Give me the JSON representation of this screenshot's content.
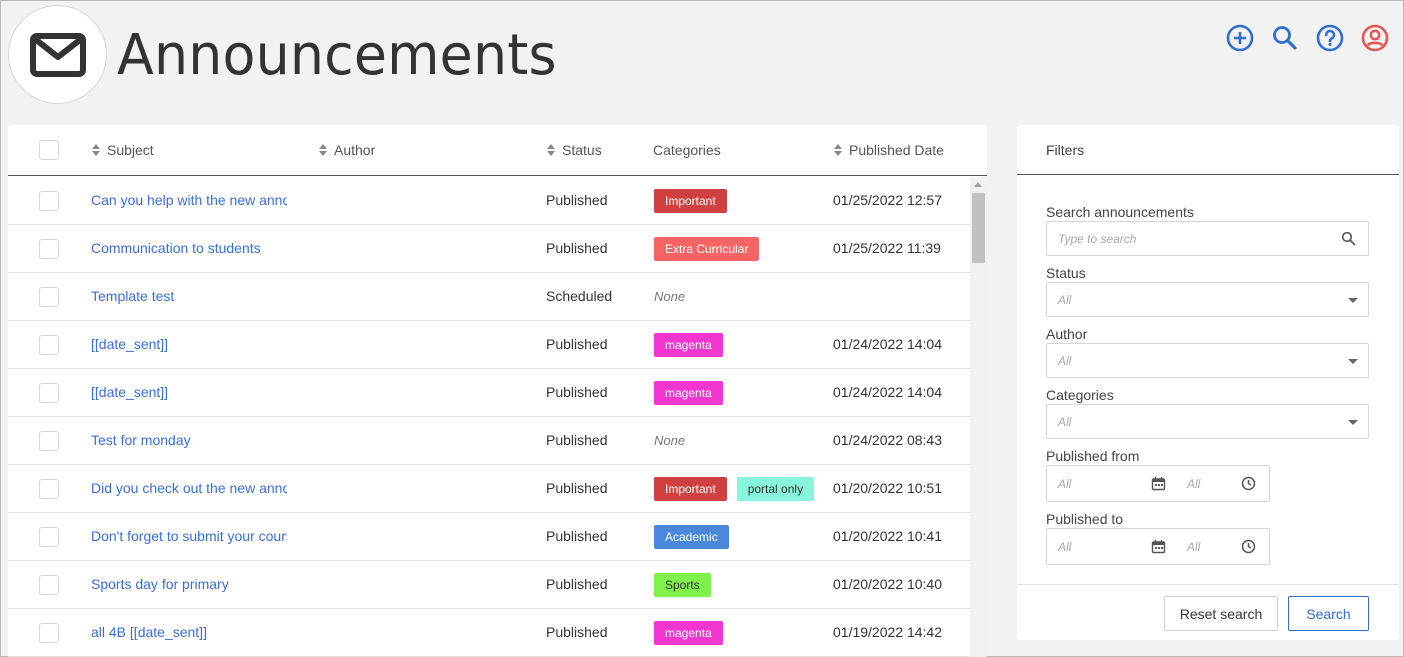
{
  "header": {
    "title": "Announcements",
    "icons": [
      "envelope-icon",
      "add-circle-icon",
      "search-icon",
      "help-circle-icon",
      "user-circle-icon"
    ]
  },
  "colors": {
    "link": "#3a6fd8",
    "accent_blue": "#2f6fcf",
    "user_icon": "#e25656"
  },
  "table": {
    "columns": {
      "subject": "Subject",
      "author": "Author",
      "status": "Status",
      "categories": "Categories",
      "published_date": "Published Date"
    },
    "rows": [
      {
        "subject": "Can you help with the new announcement",
        "status": "Published",
        "tags": [
          {
            "label": "Important",
            "color": "#d04040",
            "text": "#ffffff"
          }
        ],
        "none": "",
        "date": "01/25/2022 12:57"
      },
      {
        "subject": "Communication to students",
        "status": "Published",
        "tags": [
          {
            "label": "Extra Curricular",
            "color": "#f76464",
            "text": "#ffffff"
          }
        ],
        "none": "",
        "date": "01/25/2022 11:39"
      },
      {
        "subject": "Template test",
        "status": "Scheduled",
        "tags": [],
        "none": "None",
        "date": ""
      },
      {
        "subject": "[[date_sent]]",
        "status": "Published",
        "tags": [
          {
            "label": "magenta",
            "color": "#f236cf",
            "text": "#ffffff"
          }
        ],
        "none": "",
        "date": "01/24/2022 14:04"
      },
      {
        "subject": "[[date_sent]]",
        "status": "Published",
        "tags": [
          {
            "label": "magenta",
            "color": "#f236cf",
            "text": "#ffffff"
          }
        ],
        "none": "",
        "date": "01/24/2022 14:04"
      },
      {
        "subject": "Test for monday",
        "status": "Published",
        "tags": [],
        "none": "None",
        "date": "01/24/2022 08:43"
      },
      {
        "subject": "Did you check out the new announcement",
        "status": "Published",
        "tags": [
          {
            "label": "Important",
            "color": "#d04040",
            "text": "#ffffff"
          },
          {
            "label": "portal only",
            "color": "#86f5dc",
            "text": "#333333"
          }
        ],
        "none": "",
        "date": "01/20/2022 10:51"
      },
      {
        "subject": "Don't forget to submit your coursework",
        "status": "Published",
        "tags": [
          {
            "label": "Academic",
            "color": "#4a88dd",
            "text": "#ffffff"
          }
        ],
        "none": "",
        "date": "01/20/2022 10:41"
      },
      {
        "subject": "Sports day for primary",
        "status": "Published",
        "tags": [
          {
            "label": "Sports",
            "color": "#7ef24a",
            "text": "#333333"
          }
        ],
        "none": "",
        "date": "01/20/2022 10:40"
      },
      {
        "subject": "all 4B [[date_sent]]",
        "status": "Published",
        "tags": [
          {
            "label": "magenta",
            "color": "#f236cf",
            "text": "#ffffff"
          }
        ],
        "none": "",
        "date": "01/19/2022 14:42"
      }
    ]
  },
  "filters": {
    "title": "Filters",
    "search_label": "Search announcements",
    "search_placeholder": "Type to search",
    "status_label": "Status",
    "status_value": "All",
    "author_label": "Author",
    "author_value": "All",
    "categories_label": "Categories",
    "categories_value": "All",
    "published_from_label": "Published from",
    "published_from_date": "All",
    "published_from_time": "All",
    "published_to_label": "Published to",
    "published_to_date": "All",
    "published_to_time": "All",
    "reset_label": "Reset search",
    "search_button_label": "Search"
  }
}
